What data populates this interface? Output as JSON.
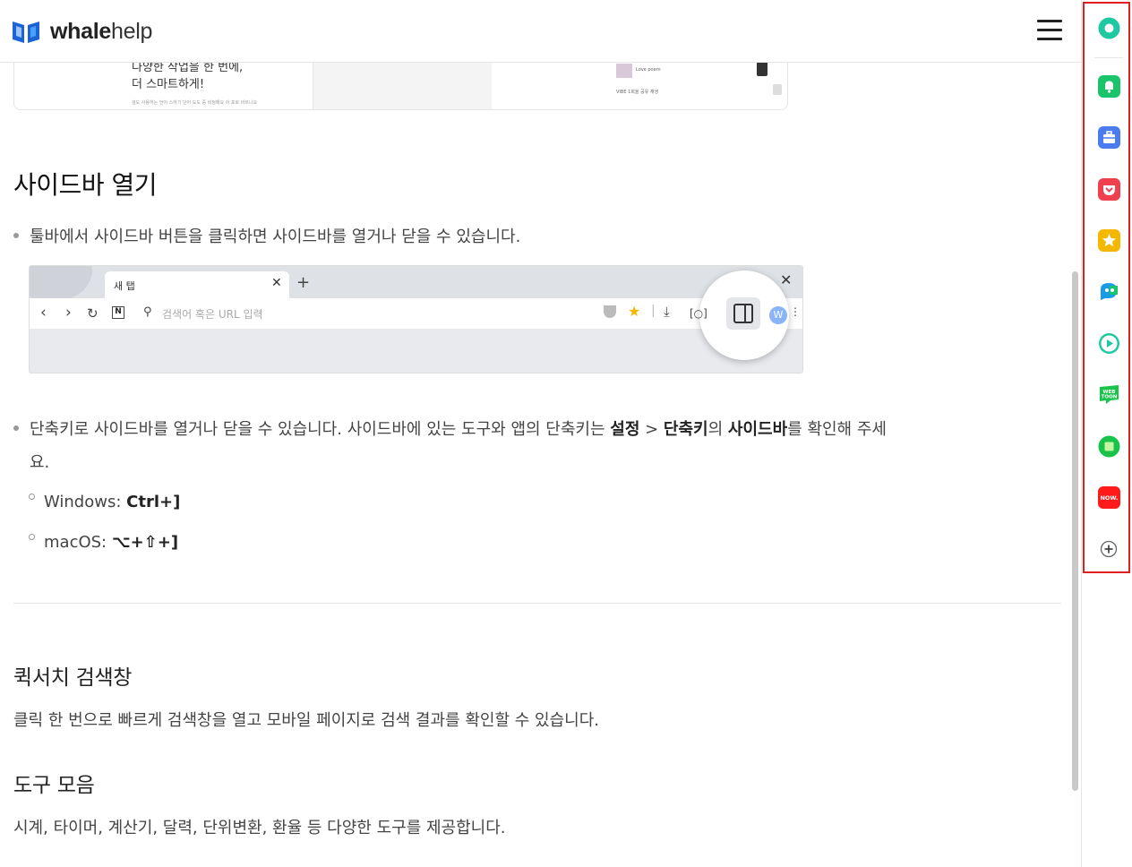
{
  "header": {
    "logo_bold": "whale",
    "logo_light": "help",
    "menu_icon": "hamburger-menu-icon"
  },
  "promo": {
    "line1": "다양한 작업을 한 번에,",
    "line2": "더 스마트하게!",
    "fine_print": "검도 사용하는 언어 스하기 단어 도도 중 비정해요 이 포로 바르니요",
    "mini1": "Love poem",
    "mini2": "VIBE 1회을 공유 재생"
  },
  "section1": {
    "title": "사이드바 열기",
    "bullet1": "툴바에서 사이드바 버튼을 클릭하면 사이드바를 열거나 닫을 수 있습니다.",
    "toolbar_image": {
      "tab_title": "새 탭",
      "search_placeholder": "검색어 혹은 URL 입력",
      "avatar_letter": "W"
    },
    "bullet2_pre": "단축키로 사이드바를 열거나 닫을 수 있습니다. 사이드바에 있는 도구와 앱의 단축키는 ",
    "bullet2_bold1": "설정",
    "bullet2_sep": " > ",
    "bullet2_bold2": "단축키",
    "bullet2_mid": "의 ",
    "bullet2_bold3": "사이드바",
    "bullet2_post": "를 확인해 주세",
    "bullet2_wrap": "요.",
    "shortcut_windows_label": "Windows: ",
    "shortcut_windows_keys": "Ctrl+]",
    "shortcut_mac_label": "macOS: ",
    "shortcut_mac_keys": "⌥+⇧+]"
  },
  "section2": {
    "title": "퀵서치 검색창",
    "desc": "클릭 한 번으로 빠르게 검색창을 열고 모바일 페이지로 검색 결과를 확인할 수 있습니다."
  },
  "section3": {
    "title": "도구 모음",
    "desc": "시계, 타이머, 계산기, 달력, 단위변환, 환율 등 다양한 도구를 제공합니다."
  },
  "sidebar_apps": [
    {
      "name": "whale-space-icon",
      "color": "#1ec8a0"
    },
    {
      "name": "notification-bell-icon",
      "color": "#19c46a"
    },
    {
      "name": "toolbox-icon",
      "color": "#4a7cf0"
    },
    {
      "name": "pocket-icon",
      "color": "#f04050"
    },
    {
      "name": "favorites-star-icon",
      "color": "#f5b800"
    },
    {
      "name": "translate-papago-icon",
      "color": "#1a9be8"
    },
    {
      "name": "media-play-icon",
      "color": "#1ec8a0"
    },
    {
      "name": "webtoon-icon",
      "color": "#19c34a"
    },
    {
      "name": "naver-calendar-icon",
      "color": "#19c34a"
    },
    {
      "name": "naver-now-icon",
      "color": "#ff1a1a"
    },
    {
      "name": "add-app-icon",
      "color": "#444444"
    }
  ],
  "colors": {
    "highlight_frame": "#e02020",
    "logo_blue": "#1b63d6"
  }
}
